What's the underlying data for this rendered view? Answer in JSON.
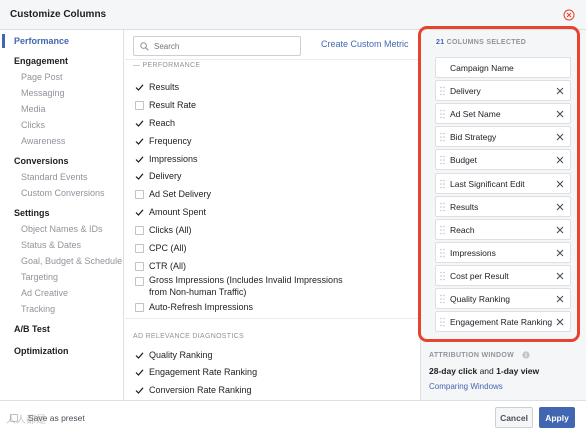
{
  "dialog": {
    "title": "Customize Columns",
    "close_icon": "close-icon"
  },
  "leftnav": {
    "items": [
      {
        "label": "Performance",
        "type": "active"
      },
      {
        "label": "Engagement",
        "type": "group"
      },
      {
        "label": "Page Post",
        "type": "sub"
      },
      {
        "label": "Messaging",
        "type": "sub"
      },
      {
        "label": "Media",
        "type": "sub"
      },
      {
        "label": "Clicks",
        "type": "sub"
      },
      {
        "label": "Awareness",
        "type": "sub"
      },
      {
        "label": "Conversions",
        "type": "group"
      },
      {
        "label": "Standard Events",
        "type": "sub"
      },
      {
        "label": "Custom Conversions",
        "type": "sub"
      },
      {
        "label": "Settings",
        "type": "group"
      },
      {
        "label": "Object Names & IDs",
        "type": "sub"
      },
      {
        "label": "Status & Dates",
        "type": "sub"
      },
      {
        "label": "Goal, Budget & Schedule",
        "type": "sub"
      },
      {
        "label": "Targeting",
        "type": "sub"
      },
      {
        "label": "Ad Creative",
        "type": "sub"
      },
      {
        "label": "Tracking",
        "type": "sub"
      },
      {
        "label": "A/B Test",
        "type": "group"
      },
      {
        "label": "Optimization",
        "type": "group"
      }
    ]
  },
  "middle": {
    "search_placeholder": "Search",
    "custom_metric_link": "Create Custom Metric",
    "section_performance": "PERFORMANCE",
    "metrics": [
      {
        "label": "Results",
        "checked": true
      },
      {
        "label": "Result Rate",
        "checked": false
      },
      {
        "label": "Reach",
        "checked": true
      },
      {
        "label": "Frequency",
        "checked": true
      },
      {
        "label": "Impressions",
        "checked": true
      },
      {
        "label": "Delivery",
        "checked": true
      },
      {
        "label": "Ad Set Delivery",
        "checked": false
      },
      {
        "label": "Amount Spent",
        "checked": true
      },
      {
        "label": "Clicks (All)",
        "checked": false
      },
      {
        "label": "CPC (All)",
        "checked": false
      },
      {
        "label": "CTR (All)",
        "checked": false
      },
      {
        "label": "Gross Impressions (Includes Invalid Impressions from Non-human Traffic)",
        "checked": false
      },
      {
        "label": "Auto-Refresh Impressions",
        "checked": false
      }
    ],
    "section_relevance": "AD RELEVANCE DIAGNOSTICS",
    "relevance_metrics": [
      {
        "label": "Quality Ranking",
        "checked": true
      },
      {
        "label": "Engagement Rate Ranking",
        "checked": true
      },
      {
        "label": "Conversion Rate Ranking",
        "checked": true
      }
    ]
  },
  "right": {
    "selected_count": "21",
    "selected_label": "COLUMNS SELECTED",
    "columns": [
      {
        "label": "Campaign Name",
        "fixed": true
      },
      {
        "label": "Delivery",
        "fixed": false
      },
      {
        "label": "Ad Set Name",
        "fixed": false
      },
      {
        "label": "Bid Strategy",
        "fixed": false
      },
      {
        "label": "Budget",
        "fixed": false
      },
      {
        "label": "Last Significant Edit",
        "fixed": false
      },
      {
        "label": "Results",
        "fixed": false
      },
      {
        "label": "Reach",
        "fixed": false
      },
      {
        "label": "Impressions",
        "fixed": false
      },
      {
        "label": "Cost per Result",
        "fixed": false
      },
      {
        "label": "Quality Ranking",
        "fixed": false
      },
      {
        "label": "Engagement Rate Ranking",
        "fixed": false
      }
    ],
    "attribution_header": "ATTRIBUTION WINDOW",
    "attribution_click": "28-day click",
    "attribution_and": "and",
    "attribution_view": "1-day view",
    "attribution_link": "Comparing Windows"
  },
  "footer": {
    "save_preset": "Save as preset",
    "watermark": "人人都是",
    "cancel": "Cancel",
    "apply": "Apply"
  },
  "colors": {
    "accent": "#4267b2",
    "highlight": "#e8432e"
  }
}
